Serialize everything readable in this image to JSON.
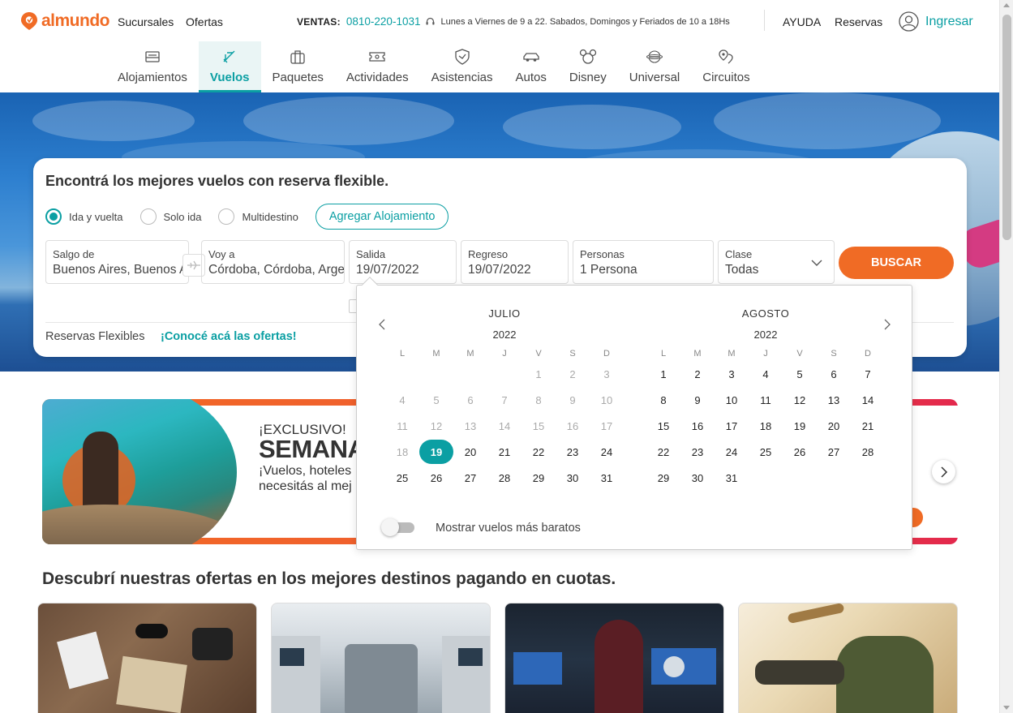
{
  "brand": {
    "name": "almundo",
    "color": "#f06b25",
    "accent": "#0b9fa3"
  },
  "top_links": {
    "sucursales": "Sucursales",
    "ofertas": "Ofertas",
    "ayuda": "AYUDA",
    "reservas": "Reservas",
    "ingresar": "Ingresar"
  },
  "ventas": {
    "label": "VENTAS:",
    "phone": "0810-220-1031",
    "hours": "Lunes a Viernes de 9 a 22. Sabados, Domingos y Feriados de 10 a 18Hs"
  },
  "nav": [
    {
      "label": "Alojamientos",
      "icon": "bed-icon"
    },
    {
      "label": "Vuelos",
      "icon": "airplane-icon",
      "active": true
    },
    {
      "label": "Paquetes",
      "icon": "suitcase-icon"
    },
    {
      "label": "Actividades",
      "icon": "ticket-icon"
    },
    {
      "label": "Asistencias",
      "icon": "shield-icon"
    },
    {
      "label": "Autos",
      "icon": "car-icon"
    },
    {
      "label": "Disney",
      "icon": "mickey-icon"
    },
    {
      "label": "Universal",
      "icon": "universal-globe-icon"
    },
    {
      "label": "Circuitos",
      "icon": "map-pin-icon"
    }
  ],
  "search": {
    "title": "Encontrá los mejores vuelos con reserva flexible.",
    "trip_types": [
      "Ida y vuelta",
      "Solo ida",
      "Multidestino"
    ],
    "selected_trip_type": "Ida y vuelta",
    "add_hotel": "Agregar Alojamiento",
    "origin": {
      "label": "Salgo de",
      "value": "Buenos Aires, Buenos Aires, Argentina"
    },
    "destination": {
      "label": "Voy a",
      "value": "Córdoba, Córdoba, Argentina"
    },
    "departure": {
      "label": "Salida",
      "value": "19/07/2022"
    },
    "return": {
      "label": "Regreso",
      "value": "19/07/2022"
    },
    "people": {
      "label": "Personas",
      "value": "1 Persona"
    },
    "class": {
      "label": "Clase",
      "value": "Todas"
    },
    "submit": "BUSCAR",
    "flex_label": "Reservas Flexibles",
    "flex_link": "¡Conocé acá las ofertas!"
  },
  "calendar": {
    "weekdays": [
      "L",
      "M",
      "M",
      "J",
      "V",
      "S",
      "D"
    ],
    "months": [
      {
        "name": "JULIO",
        "year": "2022",
        "offset": 4,
        "days": 31,
        "past_before": 19,
        "selected": 19
      },
      {
        "name": "AGOSTO",
        "year": "2022",
        "offset": 0,
        "days": 31,
        "past_before": 0,
        "selected": null
      }
    ],
    "toggle_label": "Mostrar vuelos más baratos",
    "toggle_on": false
  },
  "banner": {
    "exclusive": "¡EXCLUSIVO!",
    "title": "SEMANA",
    "sub1": "¡Vuelos, hoteles",
    "sub2": "necesitás al mej"
  },
  "offers_title": "Descubrí nuestras ofertas en los mejores destinos pagando en cuotas."
}
